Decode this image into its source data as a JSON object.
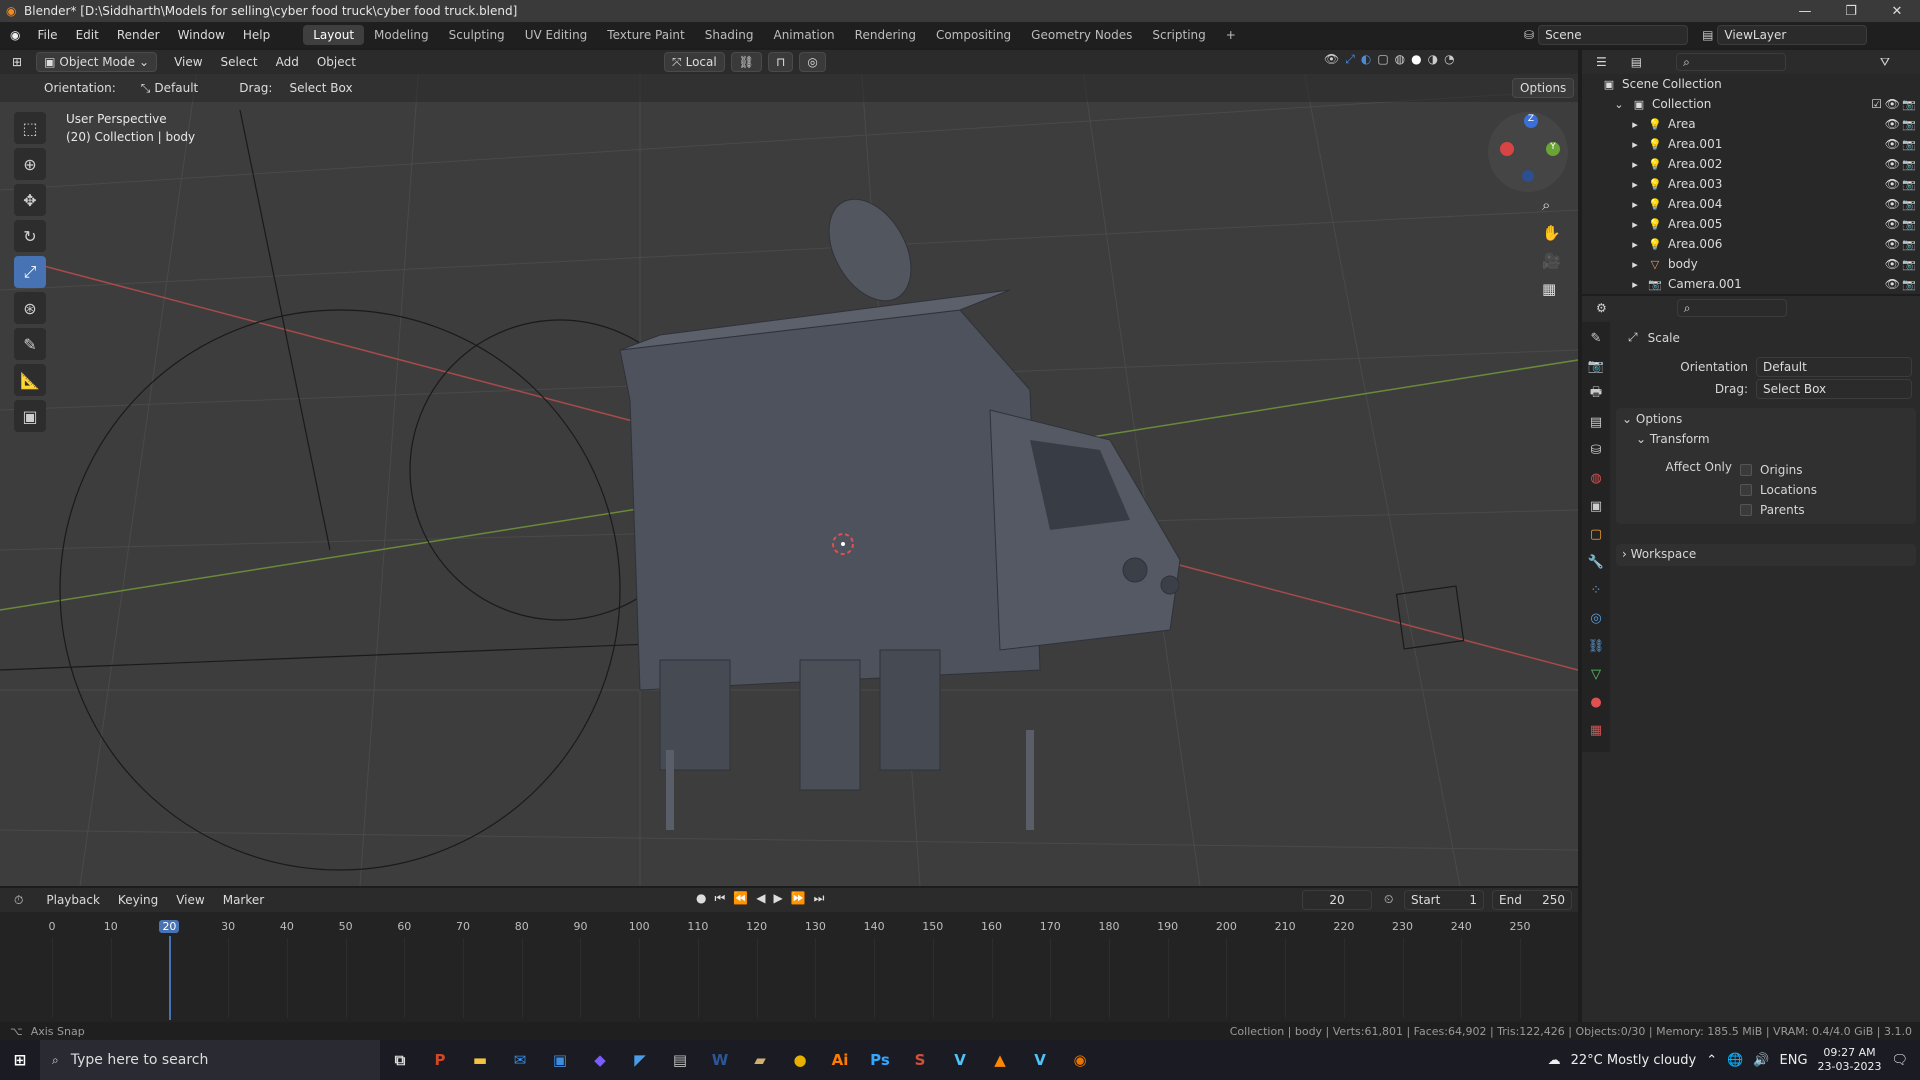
{
  "window": {
    "title": "Blender* [D:\\Siddharth\\Models for selling\\cyber food truck\\cyber food truck.blend]",
    "min": "—",
    "max": "❐",
    "close": "✕"
  },
  "topbar": {
    "menus": [
      "File",
      "Edit",
      "Render",
      "Window",
      "Help"
    ],
    "workspaces": [
      "Layout",
      "Modeling",
      "Sculpting",
      "UV Editing",
      "Texture Paint",
      "Shading",
      "Animation",
      "Rendering",
      "Compositing",
      "Geometry Nodes",
      "Scripting",
      "+"
    ],
    "active_workspace": "Layout",
    "scene": "Scene",
    "view_layer": "ViewLayer"
  },
  "viewport": {
    "mode": "Object Mode",
    "menus": [
      "View",
      "Select",
      "Add",
      "Object"
    ],
    "pivot": "Local",
    "orientation_label": "Orientation:",
    "orientation_value": "Default",
    "drag_label": "Drag:",
    "drag_value": "Select Box",
    "options": "Options",
    "info_line1": "User Perspective",
    "info_line2": "(20) Collection | body",
    "gizmo": {
      "z": "Z",
      "y": "Y",
      "x": "X"
    }
  },
  "outliner": {
    "root": "Scene Collection",
    "collection": "Collection",
    "items": [
      {
        "name": "Area",
        "icon": "light-icon"
      },
      {
        "name": "Area.001",
        "icon": "light-icon"
      },
      {
        "name": "Area.002",
        "icon": "light-icon"
      },
      {
        "name": "Area.003",
        "icon": "light-icon"
      },
      {
        "name": "Area.004",
        "icon": "light-icon"
      },
      {
        "name": "Area.005",
        "icon": "light-icon"
      },
      {
        "name": "Area.006",
        "icon": "light-icon"
      },
      {
        "name": "body",
        "icon": "mesh-icon"
      },
      {
        "name": "Camera.001",
        "icon": "camera-icon"
      }
    ]
  },
  "properties": {
    "tool_name": "Scale",
    "orientation_label": "Orientation",
    "orientation_value": "Default",
    "drag_label": "Drag:",
    "drag_value": "Select Box",
    "options_panel": "Options",
    "transform_panel": "Transform",
    "affect_only": "Affect Only",
    "checkboxes": [
      "Origins",
      "Locations",
      "Parents"
    ],
    "workspace_panel": "Workspace"
  },
  "timeline": {
    "menus": [
      "Playback",
      "Keying",
      "View",
      "Marker"
    ],
    "current_frame": "20",
    "start_label": "Start",
    "start": "1",
    "end_label": "End",
    "end": "250",
    "ticks": [
      "0",
      "10",
      "20",
      "30",
      "40",
      "50",
      "60",
      "70",
      "80",
      "90",
      "100",
      "110",
      "120",
      "130",
      "140",
      "150",
      "160",
      "170",
      "180",
      "190",
      "200",
      "210",
      "220",
      "230",
      "240",
      "250"
    ]
  },
  "status": {
    "left": "Axis Snap",
    "right": "Collection | body | Verts:61,801 | Faces:64,902 | Tris:122,426 | Objects:0/30 | Memory: 185.5 MiB | VRAM: 0.4/4.0 GiB | 3.1.0"
  },
  "taskbar": {
    "search_placeholder": "Type here to search",
    "apps": [
      {
        "label": "P",
        "name": "powerpoint-icon",
        "color": "#d24726"
      },
      {
        "label": "▬",
        "name": "file-explorer-icon",
        "color": "#f4c542"
      },
      {
        "label": "✉",
        "name": "mail-icon",
        "color": "#3d8ee0"
      },
      {
        "label": "▣",
        "name": "store-icon",
        "color": "#3d8ee0"
      },
      {
        "label": "◆",
        "name": "app-icon",
        "color": "#7a5cff"
      },
      {
        "label": "◤",
        "name": "app2-icon",
        "color": "#4a9be8"
      },
      {
        "label": "▤",
        "name": "app3-icon",
        "color": "#c0c0c0"
      },
      {
        "label": "W",
        "name": "word-icon",
        "color": "#2b5797"
      },
      {
        "label": "▰",
        "name": "app4-icon",
        "color": "#d0b070"
      },
      {
        "label": "●",
        "name": "chrome-icon",
        "color": "#e8b100"
      },
      {
        "label": "Ai",
        "name": "illustrator-icon",
        "color": "#ff7c00"
      },
      {
        "label": "Ps",
        "name": "photoshop-icon",
        "color": "#31a8ff"
      },
      {
        "label": "S",
        "name": "app5-icon",
        "color": "#d0503a"
      },
      {
        "label": "V",
        "name": "app6-icon",
        "color": "#4fc3f7"
      },
      {
        "label": "▲",
        "name": "vlc-icon",
        "color": "#ff8800"
      },
      {
        "label": "V",
        "name": "app7-icon",
        "color": "#4fc3f7"
      },
      {
        "label": "◉",
        "name": "blender-icon",
        "color": "#ea7600"
      }
    ],
    "weather": "22°C  Mostly cloudy",
    "lang": "ENG",
    "time": "09:27 AM",
    "date": "23-03-2023"
  }
}
